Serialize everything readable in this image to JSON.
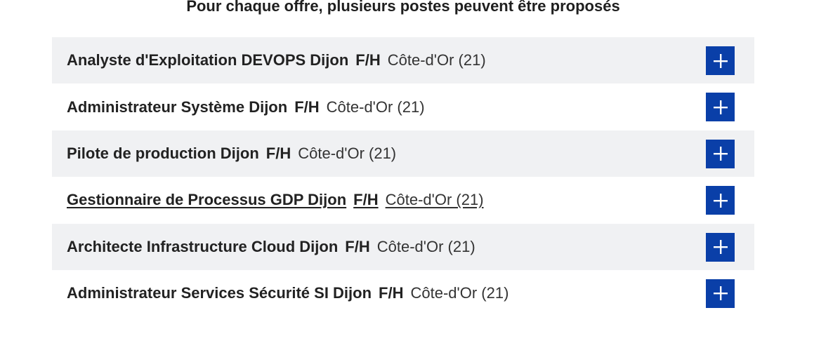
{
  "heading": "Pour chaque offre, plusieurs postes peuvent être proposés",
  "accent_color": "#0a3fa8",
  "row_alt_color": "#f0f1f3",
  "offers": [
    {
      "title": "Analyste d'Exploitation DEVOPS Dijon",
      "gender": "F/H",
      "location": "Côte-d'Or (21)",
      "icon": "plus-icon"
    },
    {
      "title": "Administrateur Système Dijon",
      "gender": "F/H",
      "location": "Côte-d'Or (21)",
      "icon": "plus-icon"
    },
    {
      "title": "Pilote de production Dijon",
      "gender": "F/H",
      "location": "Côte-d'Or (21)",
      "icon": "plus-icon"
    },
    {
      "title": "Gestionnaire de Processus GDP Dijon",
      "gender": "F/H",
      "location": "Côte-d'Or (21)",
      "icon": "plus-icon"
    },
    {
      "title": "Architecte Infrastructure Cloud Dijon",
      "gender": "F/H",
      "location": "Côte-d'Or (21)",
      "icon": "plus-icon"
    },
    {
      "title": "Administrateur Services Sécurité SI Dijon",
      "gender": "F/H",
      "location": "Côte-d'Or (21)",
      "icon": "plus-icon"
    }
  ]
}
